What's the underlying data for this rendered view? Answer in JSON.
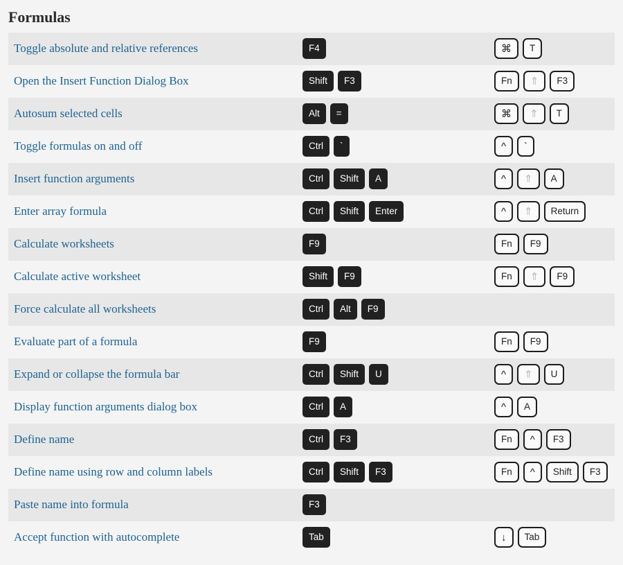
{
  "page": {
    "title": "Formulas",
    "colors": {
      "link_blue": "#1f6393",
      "row_odd_bg": "#e7e7e7",
      "row_even_bg": "#f4f4f4",
      "page_bg": "#f4f4f4",
      "win_key_bg": "#212121",
      "win_key_fg": "#ffffff",
      "mac_key_bg": "#fafafa",
      "mac_key_border": "#1d1d1d",
      "mac_key_dim_fg": "#b5b5b5",
      "title_fg": "#2b2b2b"
    }
  },
  "rows": [
    {
      "description": "Toggle absolute and relative references",
      "windows": [
        "F4"
      ],
      "mac": [
        "⌘",
        "T"
      ],
      "mac_dim": [
        false,
        false
      ]
    },
    {
      "description": "Open the Insert Function Dialog Box",
      "windows": [
        "Shift",
        "F3"
      ],
      "mac": [
        "Fn",
        "⇑",
        "F3"
      ],
      "mac_dim": [
        false,
        true,
        false
      ]
    },
    {
      "description": "Autosum selected cells",
      "windows": [
        "Alt",
        "="
      ],
      "mac": [
        "⌘",
        "⇑",
        "T"
      ],
      "mac_dim": [
        false,
        true,
        false
      ]
    },
    {
      "description": "Toggle formulas on and off",
      "windows": [
        "Ctrl",
        "`"
      ],
      "mac": [
        "^",
        "`"
      ],
      "mac_dim": [
        false,
        false
      ]
    },
    {
      "description": "Insert function arguments",
      "windows": [
        "Ctrl",
        "Shift",
        "A"
      ],
      "mac": [
        "^",
        "⇑",
        "A"
      ],
      "mac_dim": [
        false,
        true,
        false
      ]
    },
    {
      "description": "Enter array formula",
      "windows": [
        "Ctrl",
        "Shift",
        "Enter"
      ],
      "mac": [
        "^",
        "⇑",
        "Return"
      ],
      "mac_dim": [
        false,
        true,
        false
      ]
    },
    {
      "description": "Calculate worksheets",
      "windows": [
        "F9"
      ],
      "mac": [
        "Fn",
        "F9"
      ],
      "mac_dim": [
        false,
        false
      ]
    },
    {
      "description": "Calculate active worksheet",
      "windows": [
        "Shift",
        "F9"
      ],
      "mac": [
        "Fn",
        "⇑",
        "F9"
      ],
      "mac_dim": [
        false,
        true,
        false
      ]
    },
    {
      "description": "Force calculate all worksheets",
      "windows": [
        "Ctrl",
        "Alt",
        "F9"
      ],
      "mac": [],
      "mac_dim": []
    },
    {
      "description": "Evaluate part of a formula",
      "windows": [
        "F9"
      ],
      "mac": [
        "Fn",
        "F9"
      ],
      "mac_dim": [
        false,
        false
      ]
    },
    {
      "description": "Expand or collapse the formula bar",
      "windows": [
        "Ctrl",
        "Shift",
        "U"
      ],
      "mac": [
        "^",
        "⇑",
        "U"
      ],
      "mac_dim": [
        false,
        true,
        false
      ]
    },
    {
      "description": "Display function arguments dialog box",
      "windows": [
        "Ctrl",
        "A"
      ],
      "mac": [
        "^",
        "A"
      ],
      "mac_dim": [
        false,
        false
      ]
    },
    {
      "description": "Define name",
      "windows": [
        "Ctrl",
        "F3"
      ],
      "mac": [
        "Fn",
        "^",
        "F3"
      ],
      "mac_dim": [
        false,
        false,
        false
      ]
    },
    {
      "description": "Define name using row and column labels",
      "windows": [
        "Ctrl",
        "Shift",
        "F3"
      ],
      "mac": [
        "Fn",
        "^",
        "Shift",
        "F3"
      ],
      "mac_dim": [
        false,
        false,
        false,
        false
      ]
    },
    {
      "description": "Paste name into formula",
      "windows": [
        "F3"
      ],
      "mac": [],
      "mac_dim": []
    },
    {
      "description": "Accept function with autocomplete",
      "windows": [
        "Tab"
      ],
      "mac": [
        "↓",
        "Tab"
      ],
      "mac_dim": [
        false,
        false
      ]
    }
  ]
}
